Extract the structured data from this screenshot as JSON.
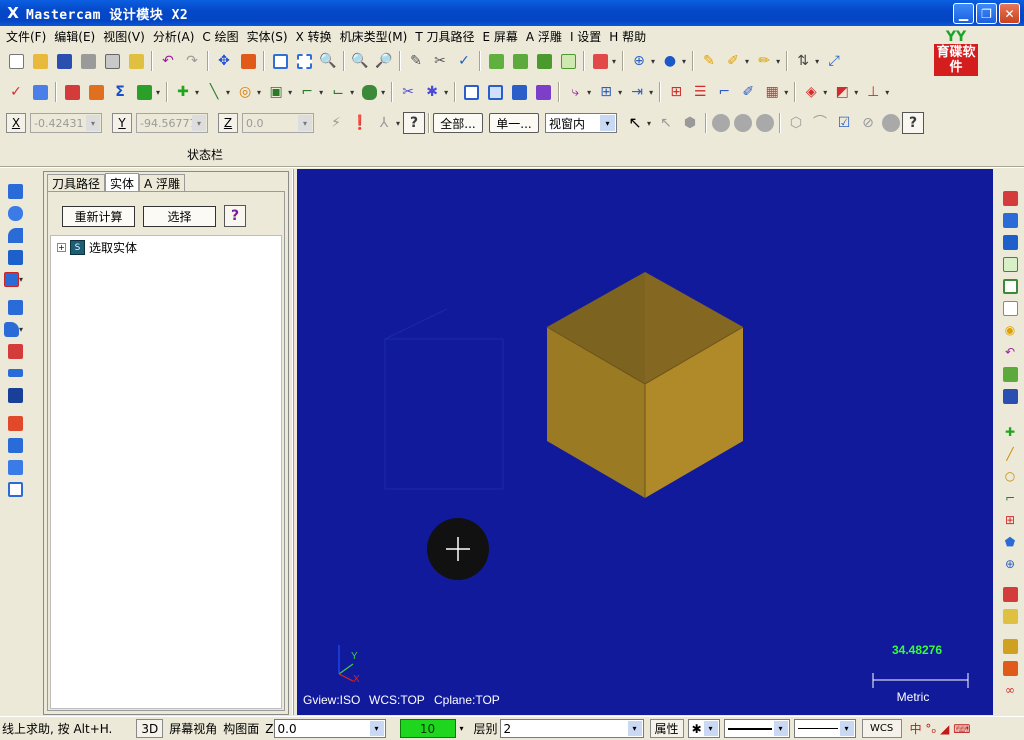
{
  "window": {
    "title": "Mastercam 设计模块  X2",
    "logo_text": "育碟软件",
    "logo_mark": "YY"
  },
  "menu": [
    "文件(F)",
    "编辑(E)",
    "视图(V)",
    "分析(A)",
    "C 绘图",
    "实体(S)",
    "X 转换",
    "机床类型(M)",
    "T 刀具路径",
    "E 屏幕",
    "A 浮雕",
    "I 设置",
    "H 帮助"
  ],
  "coords": {
    "x_label": "X",
    "x_value": "-0.42431",
    "y_label": "Y",
    "y_value": "-94.56777",
    "z_label": "Z",
    "z_value": "0.0",
    "all_button": "全部...",
    "single_button": "单一...",
    "select_mode": "视窗内"
  },
  "status_bar_label": "状态栏",
  "manager": {
    "tabs": [
      "刀具路径",
      "实体",
      "A 浮雕"
    ],
    "active_tab": "实体",
    "recalc_button": "重新计算",
    "select_button": "选择",
    "help_button": "?",
    "tree_item": "选取实体",
    "tree_icon": "S"
  },
  "viewport": {
    "background": "#111a9b",
    "solid_color": "#9b7a24",
    "gview": "Gview:ISO",
    "wcs": "WCS:TOP",
    "cplane": "Cplane:TOP",
    "scale_value": "34.48276",
    "scale_unit": "Metric",
    "axis_y": "Y",
    "axis_x": "X"
  },
  "bottom": {
    "hint": "线上求助, 按 Alt+H.",
    "btn_3d": "3D",
    "screen_view": "屏幕视角",
    "construction_plane": "构图面",
    "z_label": "Z",
    "z_value": "0.0",
    "level_value": "10",
    "layer_label": "层别",
    "layer_value": "2",
    "attributes": "属性",
    "wcs": "WCS"
  }
}
